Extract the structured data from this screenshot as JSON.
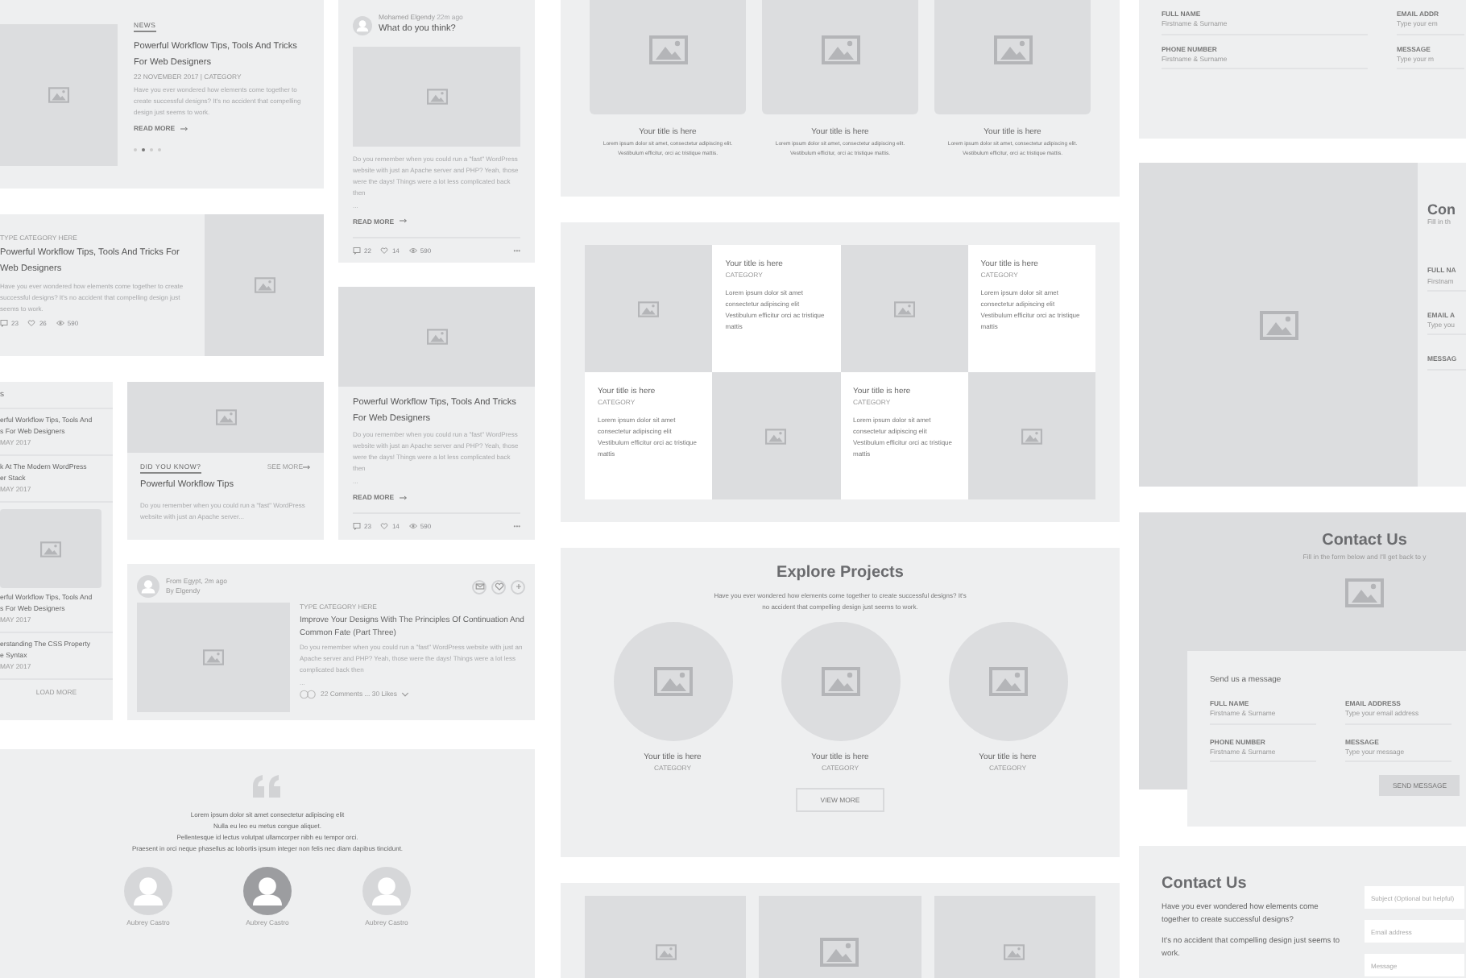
{
  "news_card": {
    "tag": "NEWS",
    "title": "Powerful Workflow Tips, Tools And Tricks For Web Designers",
    "meta": "22 NOVEMBER 2017 | CATEGORY",
    "excerpt": "Have you ever wondered how elements come together to create successful designs? It's no accident that compelling design just seems to work.",
    "link": "READ MORE",
    "dots": [
      {
        "selected": false
      },
      {
        "selected": true
      },
      {
        "selected": false
      },
      {
        "selected": false
      }
    ]
  },
  "question_card": {
    "author": "Mohamed Elgendy",
    "time": "22m ago",
    "question": "What do you think?",
    "excerpt": "Do you remember when you could run a \"fast\" WordPress website with just an Apache server and PHP? Yeah, those were the days! Things were a lot less complicated back then",
    "ellipsis": "...",
    "link": "READ MORE",
    "stats": [
      {
        "kind": "comments",
        "count": "22"
      },
      {
        "kind": "likes",
        "count": "14"
      },
      {
        "kind": "views",
        "count": "590"
      }
    ],
    "more": "•••"
  },
  "category_card": {
    "category": "TYPE CATEGORY HERE",
    "title": "Powerful Workflow Tips, Tools And Tricks For Web Designers",
    "excerpt": "Have you ever wondered how elements come together to create successful designs? It's no accident that compelling design just seems to work.",
    "stats": [
      {
        "kind": "comments",
        "count": "23"
      },
      {
        "kind": "likes",
        "count": "26"
      },
      {
        "kind": "views",
        "count": "590"
      }
    ]
  },
  "image_post_card": {
    "title": "Powerful Workflow Tips, Tools And Tricks For Web Designers",
    "excerpt": "Do you remember when you could run a \"fast\" WordPress website with just an Apache server and PHP? Yeah, those were the days! Things were a lot less complicated back then",
    "ellipsis": "...",
    "link": "READ MORE",
    "stats": [
      {
        "kind": "comments",
        "count": "23"
      },
      {
        "kind": "likes",
        "count": "14"
      },
      {
        "kind": "views",
        "count": "590"
      }
    ],
    "more": "•••"
  },
  "sidebar_list": {
    "heading": "s",
    "items": [
      {
        "kind": "text",
        "lines": [
          "erful Workflow Tips, Tools And",
          "s For Web Designers"
        ],
        "date": "MAY 2017"
      },
      {
        "kind": "text",
        "lines": [
          "k At The Modern WordPress",
          "er Stack"
        ],
        "date": "MAY 2017"
      },
      {
        "kind": "image",
        "lines": [
          "erful Workflow Tips, Tools And",
          "s For Web Designers"
        ],
        "date": "MAY 2017"
      },
      {
        "kind": "text",
        "lines": [
          "erstanding The CSS Property",
          "e Syntax"
        ],
        "date": "MAY 2017"
      }
    ],
    "load_more": "LOAD MORE"
  },
  "tip_card": {
    "label": "DID YOU KNOW?",
    "see_more": "SEE MORE",
    "title": "Powerful Workflow Tips",
    "excerpt": "Do you remember when you could run a \"fast\" WordPress website with just an Apache server..."
  },
  "feed_card": {
    "from": "From Egypt, 2m ago",
    "by": "By Elgendy",
    "category": "TYPE CATEGORY HERE",
    "title": "Improve Your Designs With The Principles Of Continuation And Common Fate (Part Three)",
    "excerpt": "Do you remember when you could run a \"fast\" WordPress website with just an Apache server and PHP? Yeah, those were the days! Things were a lot less complicated back then",
    "ellipsis": "...",
    "reactions": "22 Comments ... 30 Likes"
  },
  "testimonial": {
    "lines": [
      "Lorem ipsum dolor sit amet consectetur adipiscing elit",
      "Nulla eu leo eu metus congue aliquet.",
      "Pellentesque id lectus volutpat ullamcorper nibh eu tempor orci.",
      "Praesent in orci neque phasellus ac lobortis ipsum integer non felis nec diam dapibus tincidunt."
    ],
    "people": [
      {
        "name": "Aubrey Castro",
        "selected": false
      },
      {
        "name": "Aubrey Castro",
        "selected": true
      },
      {
        "name": "Aubrey Castro",
        "selected": false
      }
    ]
  },
  "features": [
    {
      "title": "Your title is here",
      "text": "Lorem ipsum dolor sit amet, consectetur adipiscing elit. Vestibulum efficitur, orci ac tristique mattis."
    },
    {
      "title": "Your title is here",
      "text": "Lorem ipsum dolor sit amet, consectetur adipiscing elit. Vestibulum efficitur, orci ac tristique mattis."
    },
    {
      "title": "Your title is here",
      "text": "Lorem ipsum dolor sit amet, consectetur adipiscing elit. Vestibulum efficitur, orci ac tristique mattis."
    }
  ],
  "tile_grid": [
    {
      "kind": "image"
    },
    {
      "kind": "text",
      "title": "Your title is here",
      "category": "CATEGORY",
      "text": "Lorem ipsum dolor sit amet consectetur adipiscing elit Vestibulum efficitur orci ac tristique mattis"
    },
    {
      "kind": "image"
    },
    {
      "kind": "text",
      "title": "Your title is here",
      "category": "CATEGORY",
      "text": "Lorem ipsum dolor sit amet consectetur adipiscing elit Vestibulum efficitur orci ac tristique mattis"
    },
    {
      "kind": "text",
      "title": "Your title is here",
      "category": "CATEGORY",
      "text": "Lorem ipsum dolor sit amet consectetur adipiscing elit Vestibulum efficitur orci ac tristique mattis"
    },
    {
      "kind": "image"
    },
    {
      "kind": "text",
      "title": "Your title is here",
      "category": "CATEGORY",
      "text": "Lorem ipsum dolor sit amet consectetur adipiscing elit Vestibulum efficitur orci ac tristique mattis"
    },
    {
      "kind": "image"
    }
  ],
  "projects": {
    "title": "Explore Projects",
    "subtitle": "Have you ever wondered how elements come together to create successful designs? It's no accident that compelling design just seems to work.",
    "items": [
      {
        "title": "Your title is here",
        "category": "CATEGORY"
      },
      {
        "title": "Your title is here",
        "category": "CATEGORY"
      },
      {
        "title": "Your title is here",
        "category": "CATEGORY"
      }
    ],
    "button": "VIEW MORE"
  },
  "form_strip": {
    "fields": [
      {
        "label": "FULL NAME",
        "placeholder": "Firstname & Surname"
      },
      {
        "label": "EMAIL ADDR",
        "placeholder": "Type your em"
      },
      {
        "label": "PHONE NUMBER",
        "placeholder": "Firstname & Surname"
      },
      {
        "label": "MESSAGE",
        "placeholder": "Type your m"
      }
    ]
  },
  "split_contact": {
    "title": "Con",
    "subtitle": "Fill in th",
    "fields": [
      {
        "label": "FULL NA",
        "placeholder": "Firstnam"
      },
      {
        "label": "EMAIL A",
        "placeholder": "Type you"
      },
      {
        "label": "MESSAG"
      }
    ]
  },
  "contact_banner": {
    "title": "Contact Us",
    "subtitle": "Fill in the form below and I'll get back to y",
    "form_title": "Send us a message",
    "fields": [
      {
        "label": "FULL NAME",
        "placeholder": "Firstname & Surname"
      },
      {
        "label": "EMAIL ADDRESS",
        "placeholder": "Type your email address"
      },
      {
        "label": "PHONE NUMBER",
        "placeholder": "Firstname & Surname"
      },
      {
        "label": "MESSAGE",
        "placeholder": "Type your message"
      }
    ],
    "button": "SEND MESSAGE"
  },
  "contact_section": {
    "title": "Contact Us",
    "paragraphs": [
      "Have you ever wondered how elements come together to create successful designs?",
      "It's no accident that compelling design just seems to work."
    ],
    "inputs": [
      {
        "placeholder": "Subject (Optional but helpful)"
      },
      {
        "placeholder": "Email address"
      },
      {
        "placeholder": "Message"
      }
    ]
  }
}
